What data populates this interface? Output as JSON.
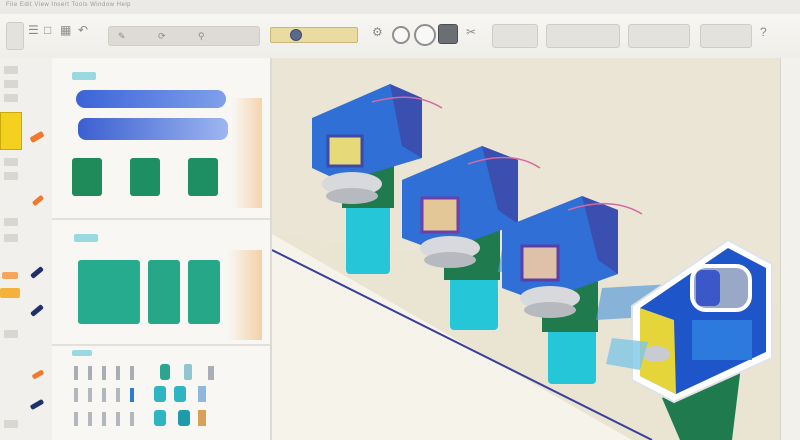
{
  "window": {
    "title": "File Edit View Insert Tools Window Help"
  },
  "toolbar": {
    "icons": [
      "file-icon",
      "open-icon",
      "save-icon",
      "undo-icon",
      "redo-icon",
      "cut-icon",
      "copy-icon",
      "paste-icon",
      "measure-icon",
      "rotate-icon",
      "zoom-icon",
      "display-icon",
      "settings-icon",
      "help-icon"
    ],
    "search_placeholder": ""
  },
  "left_panel": {
    "sections": [
      "part-library",
      "component-library",
      "fastener-library"
    ]
  },
  "viewport": {
    "model": "conveyor-assembly",
    "colors": {
      "housing": "#2f6fd6",
      "support": "#1f7a4d",
      "column": "#22c4d6",
      "accent": "#e6d53a",
      "shadow": "#3f4aa8"
    }
  }
}
